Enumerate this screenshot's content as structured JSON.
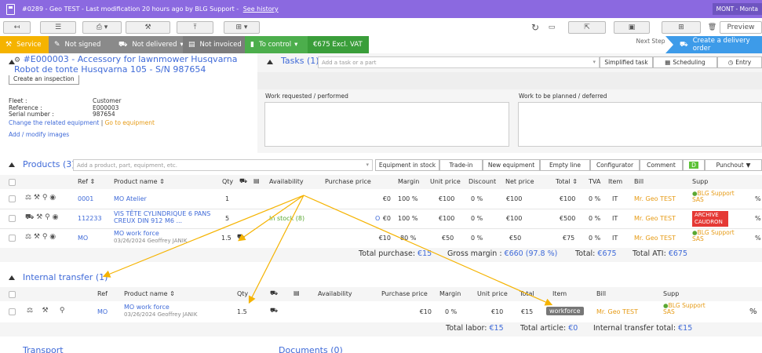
{
  "topbar": {
    "title": "#0289 - Geo TEST - Last modification 20 hours ago by BLG Support - ",
    "history_link": "See history",
    "user": "MONT - Monta"
  },
  "toolbar": {
    "preview": "Preview"
  },
  "status": {
    "service": "Service",
    "not_signed": "Not signed",
    "not_delivered": "Not delivered",
    "not_invoiced": "Not invoiced",
    "to_control": "To control",
    "excl_vat": "€675 Excl. VAT",
    "next_step": "Next Step",
    "create_delivery": "Create a delivery order"
  },
  "equipment": {
    "title_line1": "#E000003 - Accessory for lawnmower Husqvarna",
    "title_line2": "Robot de tonte Husqvarna 105 - S/N 987654",
    "create_inspection": "Create an inspection",
    "fleet_label": "Fleet :",
    "fleet_value": "Customer",
    "reference_label": "Reference :",
    "reference_value": "E000003",
    "serial_label": "Serial number :",
    "serial_value": "987654",
    "change_equipment": "Change the related equipment",
    "go_to_equipment": "Go to equipment",
    "add_images": "Add / modify images"
  },
  "tasks": {
    "title": "Tasks (1)",
    "placeholder": "Add a task or a part",
    "simplified": "Simplified task",
    "scheduling": "Scheduling",
    "entry": "Entry",
    "work_requested": "Work requested / performed",
    "work_planned": "Work to be planned / deferred"
  },
  "products": {
    "title": "Products (3)",
    "placeholder": "Add a product, part, equipment, etc.",
    "buttons": [
      "Equipment in stock",
      "Trade-in",
      "New equipment",
      "Empty line",
      "Configurator",
      "Comment",
      "D",
      "Punchout"
    ],
    "headers": {
      "ref": "Ref",
      "name": "Product name",
      "qty": "Qty",
      "availability": "Availability",
      "purchase": "Purchase price",
      "margin": "Margin",
      "unit": "Unit price",
      "discount": "Discount",
      "net": "Net price",
      "total": "Total",
      "tva": "TVA",
      "item": "Item",
      "bill": "Bill",
      "supp": "Supp"
    },
    "rows": [
      {
        "ref": "0001",
        "name": "MO Atelier",
        "sub": "",
        "qty": "1",
        "availability": "",
        "purchase": "€0",
        "o": "",
        "margin": "100 %",
        "unit": "€100",
        "discount": "0 %",
        "net": "€100",
        "total": "€100",
        "tva": "0 %",
        "item": "IT",
        "bill": "Mr. Geo TEST",
        "supp": "BLG Support SAS",
        "pct": "%"
      },
      {
        "ref": "112233",
        "name": "VIS TÊTE CYLINDRIQUE 6 PANS CREUX DIN 912 M6 ...",
        "sub": "",
        "qty": "5",
        "availability": "In stock (8)",
        "purchase": "€0",
        "o": "O",
        "margin": "100 %",
        "unit": "€100",
        "discount": "0 %",
        "net": "€100",
        "total": "€500",
        "tva": "0 %",
        "item": "IT",
        "bill": "Mr. Geo TEST",
        "supp": "ARCHIVE CAUDRON",
        "pct": "%"
      },
      {
        "ref": "MO",
        "name": "MO work force",
        "sub": "03/26/2024 Geoffrey JANIK",
        "qty": "1.5",
        "availability": "",
        "purchase": "€10",
        "o": "",
        "margin": "80 %",
        "unit": "€50",
        "discount": "0 %",
        "net": "€50",
        "total": "€75",
        "tva": "0 %",
        "item": "IT",
        "bill": "Mr. Geo TEST",
        "supp": "BLG Support SAS",
        "pct": "%"
      }
    ],
    "totals": {
      "purchase_label": "Total purchase:",
      "purchase": "€15",
      "margin_label": "Gross margin :",
      "margin": "€660 (97.8 %)",
      "total_label": "Total:",
      "total": "€675",
      "ati_label": "Total ATI:",
      "ati": "€675"
    }
  },
  "transfer": {
    "title": "Internal transfer (1)",
    "headers": {
      "ref": "Ref",
      "name": "Product name",
      "qty": "Qty",
      "availability": "Availability",
      "purchase": "Purchase price",
      "margin": "Margin",
      "unit": "Unit price",
      "total": "Total",
      "item": "Item",
      "bill": "Bill",
      "supp": "Supp"
    },
    "row": {
      "ref": "MO",
      "name": "MO work force",
      "sub": "03/26/2024 Geoffrey JANIK",
      "qty": "1.5",
      "purchase": "€10",
      "margin": "0 %",
      "unit": "€10",
      "total": "€15",
      "item": "workforce",
      "bill": "Mr. Geo TEST",
      "supp": "BLG Support SAS",
      "pct": "%"
    },
    "totals": {
      "labor_label": "Total labor:",
      "labor": "€15",
      "article_label": "Total article:",
      "article": "€0",
      "transfer_label": "Internal transfer total:",
      "transfer": "€15"
    }
  },
  "bottom": {
    "transport_label": "Transport",
    "documents_label": "Documents (0)"
  },
  "colors": {
    "topbar": "#8b69e0",
    "service": "#f5b300",
    "gray_seg": "#888888",
    "to_control": "#4cae4c",
    "excl_vat": "#3a9e3a",
    "delivery": "#3d9be9",
    "link": "#3f6ad8",
    "arrow": "#f5b300"
  }
}
